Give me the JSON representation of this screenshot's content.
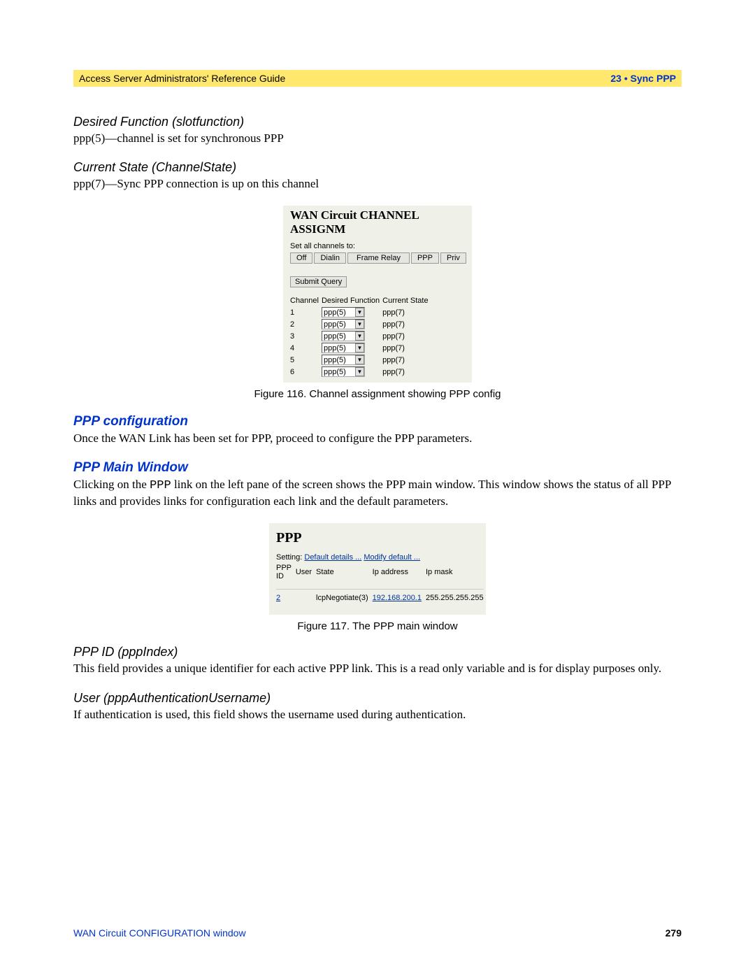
{
  "header": {
    "left": "Access Server Administrators' Reference Guide",
    "right": "23 • Sync PPP"
  },
  "sections": {
    "desired_function": {
      "title": "Desired Function (slotfunction)",
      "text": "ppp(5)—channel is set for synchronous PPP"
    },
    "current_state": {
      "title": "Current State (ChannelState)",
      "text": "ppp(7)—Sync PPP connection is up on this channel"
    },
    "ppp_config": {
      "title": "PPP configuration",
      "text": "Once the WAN Link has been set for PPP, proceed to configure the PPP parameters."
    },
    "ppp_main": {
      "title": "PPP Main Window",
      "text_before": "Clicking on the ",
      "code": "PPP",
      "text_after": " link on the left pane of the screen shows the PPP main window. This window shows the status of all PPP links and provides links for configuration each link and the default parameters."
    },
    "ppp_id": {
      "title": "PPP ID (pppIndex)",
      "text": "This field provides a unique identifier for each active PPP link. This is a read only variable and is for display purposes only."
    },
    "user": {
      "title": "User (pppAuthenticationUsername)",
      "text": "If authentication is used, this field shows the username used during authentication."
    }
  },
  "fig116": {
    "title": "WAN Circuit CHANNEL ASSIGNM",
    "set_label": "Set all channels to:",
    "buttons": {
      "off": "Off",
      "dialin": "Dialin",
      "frame": "Frame Relay",
      "ppp": "PPP",
      "priv": "Priv"
    },
    "submit": "Submit Query",
    "cols": {
      "channel": "Channel",
      "func": "Desired Function",
      "state": "Current State"
    },
    "rows": [
      {
        "ch": "1",
        "func": "ppp(5)",
        "state": "ppp(7)"
      },
      {
        "ch": "2",
        "func": "ppp(5)",
        "state": "ppp(7)"
      },
      {
        "ch": "3",
        "func": "ppp(5)",
        "state": "ppp(7)"
      },
      {
        "ch": "4",
        "func": "ppp(5)",
        "state": "ppp(7)"
      },
      {
        "ch": "5",
        "func": "ppp(5)",
        "state": "ppp(7)"
      },
      {
        "ch": "6",
        "func": "ppp(5)",
        "state": "ppp(7)"
      }
    ],
    "caption": "Figure 116. Channel assignment showing PPP config"
  },
  "fig117": {
    "title": "PPP",
    "setting_label": "Setting:",
    "link_details": "Default details ...",
    "link_modify": "Modify default ...",
    "cols": {
      "id": "PPP ID",
      "user": "User",
      "state": "State",
      "ip": "Ip address",
      "mask": "Ip mask"
    },
    "row": {
      "id": "2",
      "user": "",
      "state": "lcpNegotiate(3)",
      "ip": "192.168.200.1",
      "mask": "255.255.255.255"
    },
    "caption": "Figure 117. The PPP main window"
  },
  "footer": {
    "left": "WAN Circuit CONFIGURATION window",
    "page": "279"
  }
}
